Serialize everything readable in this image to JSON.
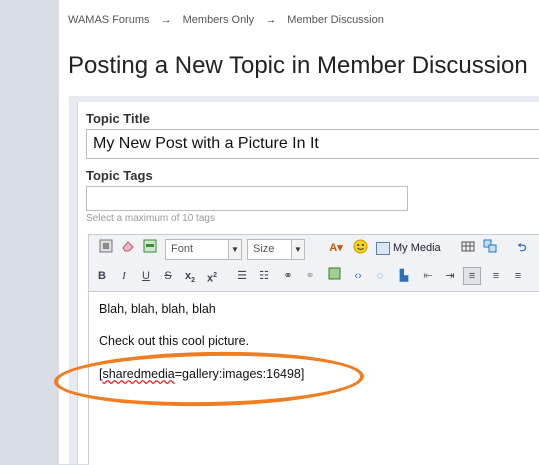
{
  "breadcrumb": {
    "items": [
      "WAMAS Forums",
      "Members Only",
      "Member Discussion"
    ],
    "separator": "→"
  },
  "page_title": "Posting a New Topic in Member Discussion",
  "form": {
    "topic_title_label": "Topic Title",
    "topic_title_value": "My New Post with a Picture In It",
    "topic_tags_label": "Topic Tags",
    "topic_tags_value": "",
    "tags_hint": "Select a maximum of 10 tags"
  },
  "editor": {
    "font_select": "Font",
    "size_select": "Size",
    "my_media_label": "My Media",
    "toolbar_row1_icons": [
      "source-icon",
      "eraser-icon",
      "toggle-editor-icon",
      "text-color-icon",
      "emoticon-icon",
      "my-media-icon",
      "table-icon",
      "special-char-icon",
      "undo-icon"
    ],
    "toolbar_row2_icons": [
      "bold-icon",
      "italic-icon",
      "underline-icon",
      "strikethrough-icon",
      "subscript-icon",
      "superscript-icon",
      "bulleted-list-icon",
      "numbered-list-icon",
      "link-icon",
      "unlink-icon",
      "image-icon",
      "code-icon",
      "quote-icon",
      "spoiler-icon",
      "outdent-icon",
      "indent-icon",
      "align-left-icon",
      "align-center-icon",
      "align-right-icon"
    ],
    "content_lines": [
      "Blah, blah, blah, blah",
      "Check out this cool picture."
    ],
    "media_tag_prefix": "sharedmedia",
    "media_tag_rest": "=gallery:images:16498]",
    "media_tag_open": "["
  },
  "annotation": {
    "color": "#ef7d22"
  }
}
